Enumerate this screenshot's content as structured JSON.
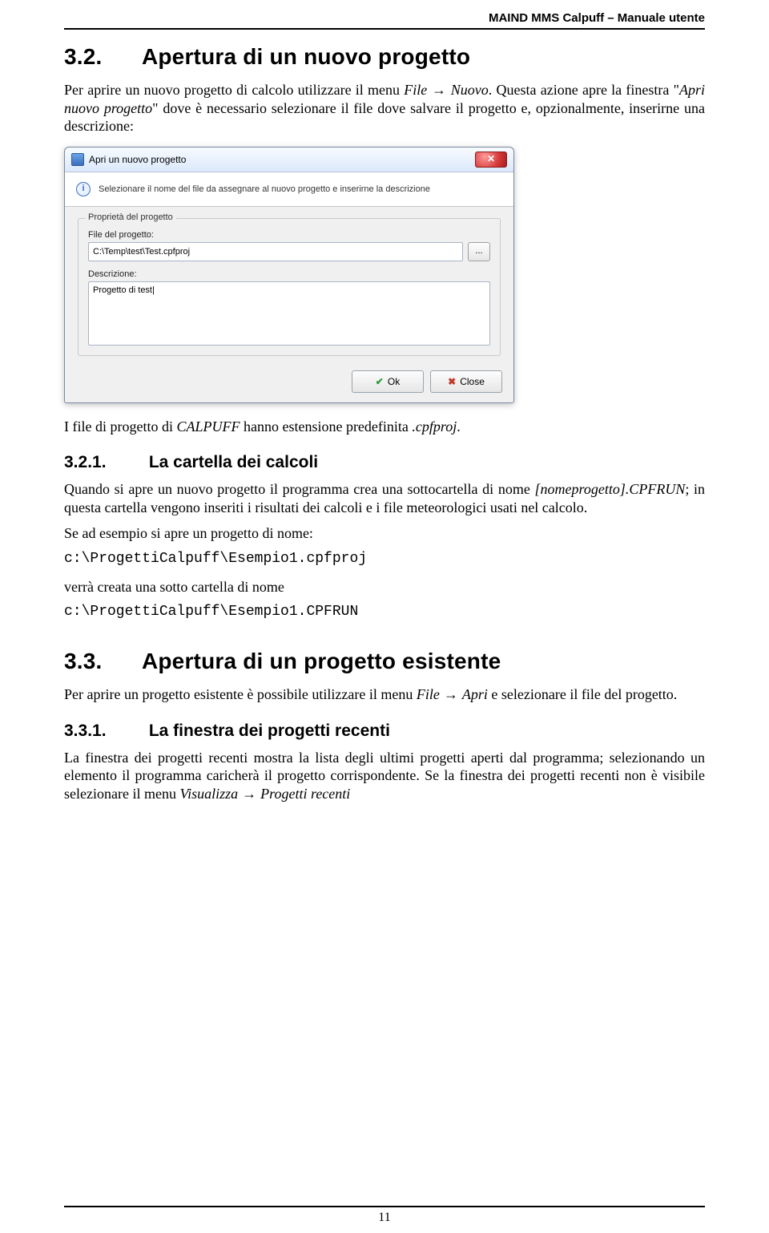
{
  "header": {
    "doc_title": "MAIND MMS Calpuff – Manuale utente"
  },
  "s32": {
    "num": "3.2.",
    "title": "Apertura di un nuovo progetto",
    "p1a": "Per aprire un nuovo progetto di calcolo utilizzare il menu ",
    "p1_menu": "File",
    "p1_arrow": " → ",
    "p1_item": "Nuovo",
    "p1_end": ". Questa azione apre la finestra \"",
    "p1_dlgname": "Apri nuovo progetto",
    "p1_after": "\" dove è necessario selezionare il file dove salvare il progetto e, opzionalmente, inserirne una descrizione:",
    "after1a": "I file di progetto di ",
    "after1b": "CALPUFF",
    "after1c": " hanno estensione predefinita ",
    "after1d": ".cpfproj",
    "after1e": "."
  },
  "dialog": {
    "title": "Apri un nuovo progetto",
    "banner": "Selezionare il nome del file da assegnare al nuovo progetto e inserirne la descrizione",
    "group_legend": "Proprietà del progetto",
    "file_label": "File del progetto:",
    "file_value": "C:\\Temp\\test\\Test.cpfproj",
    "browse_label": "...",
    "desc_label": "Descrizione:",
    "desc_value": "Progetto di test|",
    "ok": "Ok",
    "close": "Close"
  },
  "s321": {
    "num": "3.2.1.",
    "title": "La cartella dei calcoli",
    "p1a": "Quando si apre un nuovo progetto il programma crea una sottocartella di nome ",
    "p1b": "[nomeprogetto].CPFRUN",
    "p1c": "; in questa cartella vengono inseriti i risultati dei calcoli e i file meteorologici usati nel calcolo.",
    "p2": "Se ad esempio si apre un progetto di nome:",
    "code1": "c:\\ProgettiCalpuff\\Esempio1.cpfproj",
    "p3": "verrà creata una sotto cartella di nome",
    "code2": "c:\\ProgettiCalpuff\\Esempio1.CPFRUN"
  },
  "s33": {
    "num": "3.3.",
    "title": "Apertura di un progetto esistente",
    "p1a": "Per aprire un progetto esistente è possibile utilizzare il menu ",
    "p1b": "File",
    "p1_arrow": " → ",
    "p1c": "Apri",
    "p1d": " e selezionare il file del progetto."
  },
  "s331": {
    "num": "3.3.1.",
    "title": "La finestra dei progetti recenti",
    "p1a": "La finestra dei progetti recenti mostra la lista degli ultimi progetti aperti dal programma; selezionando un elemento il programma caricherà il progetto corrispondente.  Se la finestra dei progetti recenti non è visibile selezionare il menu ",
    "p1b": "Visualizza",
    "p1_arrow": " → ",
    "p1c": "Progetti recenti"
  },
  "footer": {
    "page_number": "11"
  }
}
